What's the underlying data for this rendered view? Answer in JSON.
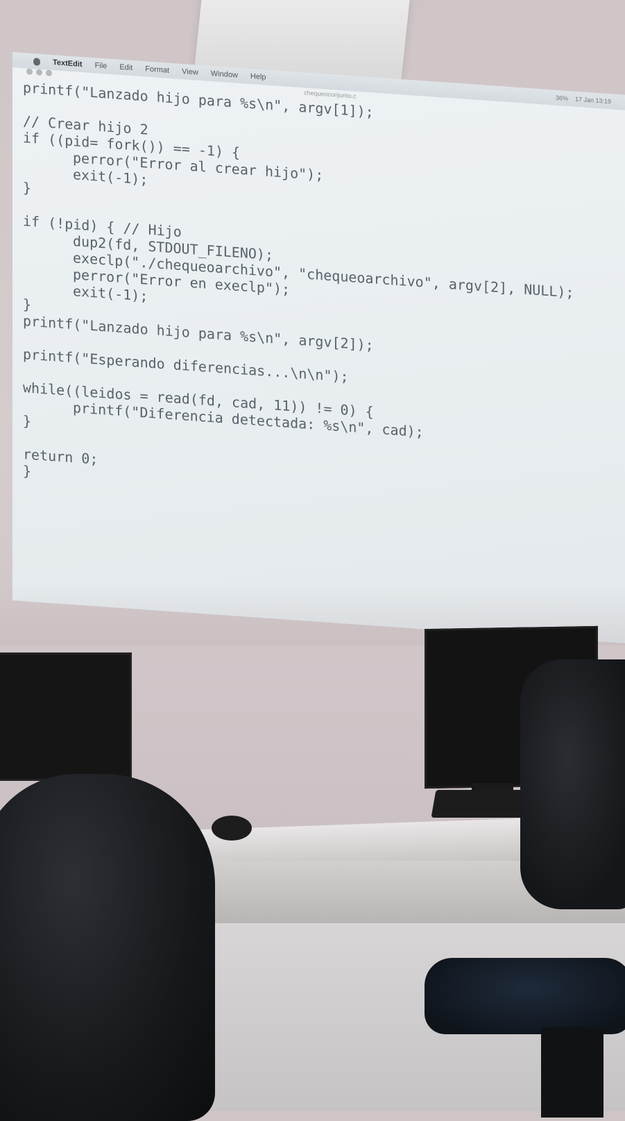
{
  "menubar": {
    "app_name": "TextEdit",
    "menus": [
      "File",
      "Edit",
      "Format",
      "View",
      "Window",
      "Help"
    ],
    "status": [
      "36%",
      "17 Jan 13:19"
    ]
  },
  "document": {
    "filename": "chequeoconjunto.c"
  },
  "code_lines": [
    {
      "indent": false,
      "text": "printf(\"Lanzado hijo para %s\\n\", argv[1]);"
    },
    {
      "indent": false,
      "text": ""
    },
    {
      "indent": false,
      "text": "// Crear hijo 2"
    },
    {
      "indent": false,
      "text": "if ((pid= fork()) == -1) {"
    },
    {
      "indent": true,
      "text": "perror(\"Error al crear hijo\");"
    },
    {
      "indent": true,
      "text": "exit(-1);"
    },
    {
      "indent": false,
      "text": "}"
    },
    {
      "indent": false,
      "text": ""
    },
    {
      "indent": false,
      "text": "if (!pid) { // Hijo"
    },
    {
      "indent": true,
      "text": "dup2(fd, STDOUT_FILENO);"
    },
    {
      "indent": true,
      "text": "execlp(\"./chequeoarchivo\", \"chequeoarchivo\", argv[2], NULL);"
    },
    {
      "indent": true,
      "text": "perror(\"Error en execlp\");"
    },
    {
      "indent": true,
      "text": "exit(-1);"
    },
    {
      "indent": false,
      "text": "}"
    },
    {
      "indent": false,
      "text": "printf(\"Lanzado hijo para %s\\n\", argv[2]);"
    },
    {
      "indent": false,
      "text": ""
    },
    {
      "indent": false,
      "text": "printf(\"Esperando diferencias...\\n\\n\");"
    },
    {
      "indent": false,
      "text": ""
    },
    {
      "indent": false,
      "text": "while((leidos = read(fd, cad, 11)) != 0) {"
    },
    {
      "indent": true,
      "text": "printf(\"Diferencia detectada: %s\\n\", cad);"
    },
    {
      "indent": false,
      "text": "}"
    },
    {
      "indent": false,
      "text": ""
    },
    {
      "indent": false,
      "text": "return 0;"
    },
    {
      "indent": false,
      "text": "}"
    }
  ],
  "colors": {
    "code_text": "#58626a",
    "screen": "#eef2f4",
    "wall": "#d6cccd"
  }
}
